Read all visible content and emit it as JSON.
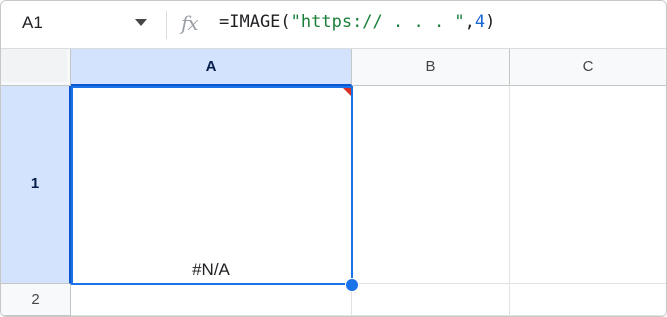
{
  "formula_bar": {
    "name_box": "A1",
    "fx_label": "fx",
    "formula": {
      "prefix": "=IMAGE(",
      "url_string": "\"https:// . . . \"",
      "separator": ",",
      "mode": "4",
      "suffix": ")"
    }
  },
  "grid": {
    "columns": [
      {
        "label": "A",
        "selected": true
      },
      {
        "label": "B",
        "selected": false
      },
      {
        "label": "C",
        "selected": false
      }
    ],
    "rows": [
      {
        "label": "1",
        "selected": true
      },
      {
        "label": "2",
        "selected": false
      }
    ],
    "cells": {
      "A1": "#N/A"
    }
  },
  "colors": {
    "selection_border": "#1a73e8",
    "header_selected_bg": "#d3e3fd",
    "error_flag": "#d93025",
    "string_token": "#188038",
    "number_token": "#1967d2"
  }
}
